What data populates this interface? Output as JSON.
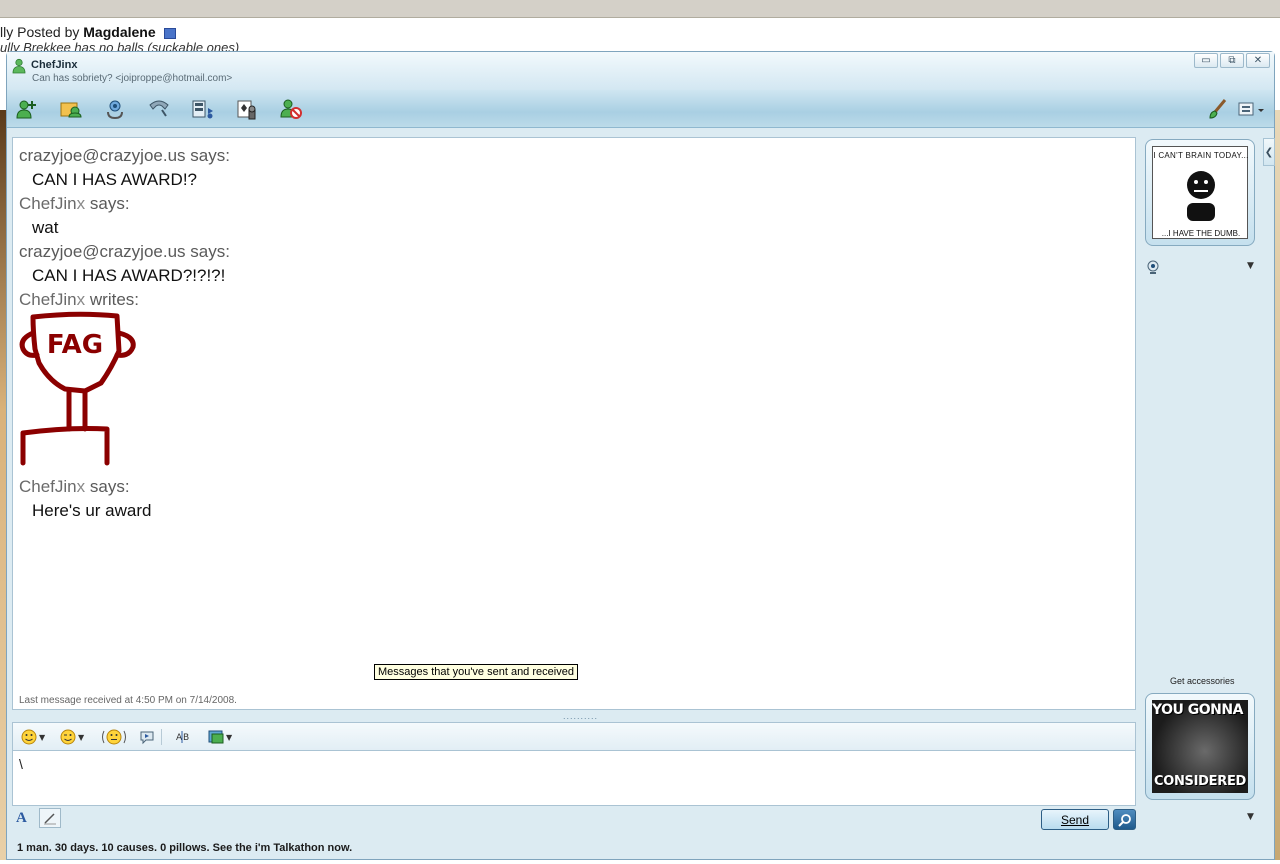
{
  "background_page": {
    "posted_prefix": "lly Posted by",
    "posted_author": "Magdalene",
    "quote_text": "ully Brekkee has no balls (suckable ones)"
  },
  "window": {
    "contact_name": "ChefJinx",
    "contact_status": "Can has sobriety? <joiproppe@hotmail.com>",
    "controls": {
      "minimize": "▭",
      "restore": "⧉",
      "close": "✕"
    }
  },
  "toolbar": {
    "icons": [
      "invite-contact-icon",
      "send-files-icon",
      "video-call-icon",
      "voice-call-icon",
      "share-media-icon",
      "games-icon",
      "block-contact-icon",
      "paint-brush-icon",
      "display-options-icon"
    ]
  },
  "conversation": {
    "messages": [
      {
        "sender": "crazyjoe@crazyjoe.us",
        "verb": "says:",
        "text": "CAN I HAS AWARD!?"
      },
      {
        "sender_a": "ChefJin",
        "sender_b": "x",
        "verb": "says:",
        "text": "wat"
      },
      {
        "sender": "crazyjoe@crazyjoe.us",
        "verb": "says:",
        "text": "CAN I HAS AWARD?!?!?!"
      },
      {
        "sender_a": "ChefJin",
        "sender_b": "x",
        "verb": "writes:",
        "ink_text": "FAG"
      },
      {
        "sender_a": "ChefJin",
        "sender_b": "x",
        "verb": "says:",
        "text": "Here's ur award"
      }
    ],
    "last_message": "Last message received at 4:50 PM on 7/14/2008.",
    "tooltip": "Messages that you've sent and received"
  },
  "input": {
    "splitter": "..........",
    "text": "\\",
    "format_font_label": "A",
    "send_label": "Send"
  },
  "status_bar": {
    "text": "1 man. 30 days. 10 causes. 0 pillows. See the i'm Talkathon now."
  },
  "side_panel": {
    "display_pic_top": "I CAN'T BRAIN TODAY...",
    "display_pic_bottom": "...I HAVE THE DUMB.",
    "get_accessories": "Get accessories",
    "accessory_top": "YOU GONNA GET",
    "accessory_bottom": "CONSIDERED"
  },
  "colors": {
    "ink": "#8b0000",
    "accent": "#2c5aa0"
  }
}
